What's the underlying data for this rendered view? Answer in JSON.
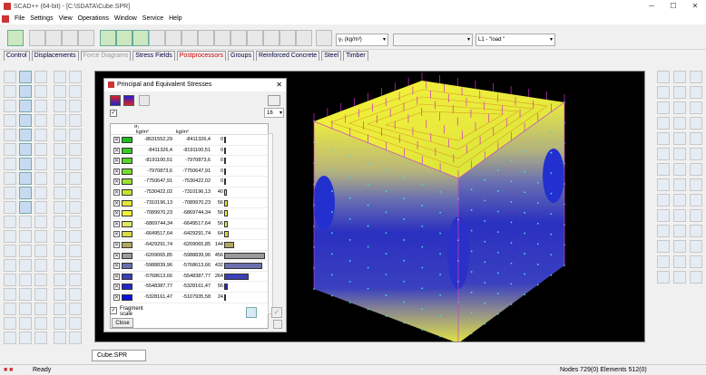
{
  "window": {
    "title": "SCAD++ (64-bit) - [C:\\SDATA\\Cube.SPR]"
  },
  "menu": [
    "File",
    "Settings",
    "View",
    "Operations",
    "Window",
    "Service",
    "Help"
  ],
  "toolbar": {
    "density_combo": "γ₁ (kg/m³)",
    "load_combo": "L1 - \"load \""
  },
  "tabs": [
    "Control",
    "Displacements",
    "Force Diagrams",
    "Stress Fields",
    "Postprocessors",
    "Groups",
    "Reinforced Concrete",
    "Steel",
    "Timber"
  ],
  "dialog": {
    "title": "Principal and Equivalent Stresses",
    "count_value": "16",
    "stress_label": "σ₁",
    "col_from_unit": "kg/m²",
    "col_to_unit": "kg/m²",
    "fragment_label": "Fragment scale",
    "close_label": "Close"
  },
  "legend_rows": [
    {
      "from": "-8631552,29",
      "to": "-8411326,4",
      "pct": "0",
      "bar": 0.005,
      "color": "#1fbf1f"
    },
    {
      "from": "-8411326,4",
      "to": "-8191100,51",
      "pct": "0",
      "bar": 0.005,
      "color": "#36cc24"
    },
    {
      "from": "-8191100,51",
      "to": "-7970873,6",
      "pct": "0",
      "bar": 0.005,
      "color": "#55d62a"
    },
    {
      "from": "-7970873,6",
      "to": "-7750647,91",
      "pct": "0",
      "bar": 0.005,
      "color": "#76dd2c"
    },
    {
      "from": "-7750647,91",
      "to": "-7530422,02",
      "pct": "0",
      "bar": 0.005,
      "color": "#9be02e"
    },
    {
      "from": "-7530422,02",
      "to": "-7310196,13",
      "pct": "40",
      "bar": 0.07,
      "color": "#c2e331"
    },
    {
      "from": "-7310196,13",
      "to": "-7089970,23",
      "pct": "56",
      "bar": 0.09,
      "color": "#e4e834"
    },
    {
      "from": "-7089970,23",
      "to": "-6869744,34",
      "pct": "56",
      "bar": 0.09,
      "color": "#eef03a"
    },
    {
      "from": "-6869744,34",
      "to": "-6649517,64",
      "pct": "56",
      "bar": 0.09,
      "color": "#e0e660"
    },
    {
      "from": "-6649517,64",
      "to": "-6429291,74",
      "pct": "64",
      "bar": 0.1,
      "color": "#d8d84a"
    },
    {
      "from": "-6429291,74",
      "to": "-6209065,85",
      "pct": "144",
      "bar": 0.23,
      "color": "#b0a860"
    },
    {
      "from": "-6209065,85",
      "to": "-5988839,96",
      "pct": "456",
      "bar": 0.98,
      "color": "#9a9a9a"
    },
    {
      "from": "-5988839,96",
      "to": "-5768613,66",
      "pct": "432",
      "bar": 0.92,
      "color": "#6a70b0"
    },
    {
      "from": "-5768613,66",
      "to": "-5548387,77",
      "pct": "264",
      "bar": 0.58,
      "color": "#3b3fb8"
    },
    {
      "from": "-5548387,77",
      "to": "-5328161,47",
      "pct": "56",
      "bar": 0.09,
      "color": "#2428c8"
    },
    {
      "from": "-5328161,47",
      "to": "-5107935,58",
      "pct": "24",
      "bar": 0.04,
      "color": "#0d10d8"
    }
  ],
  "doc_tab": "Cube.SPR",
  "status": {
    "left": "Ready",
    "right": "Nodes 729(0) Elements 512(0)"
  }
}
